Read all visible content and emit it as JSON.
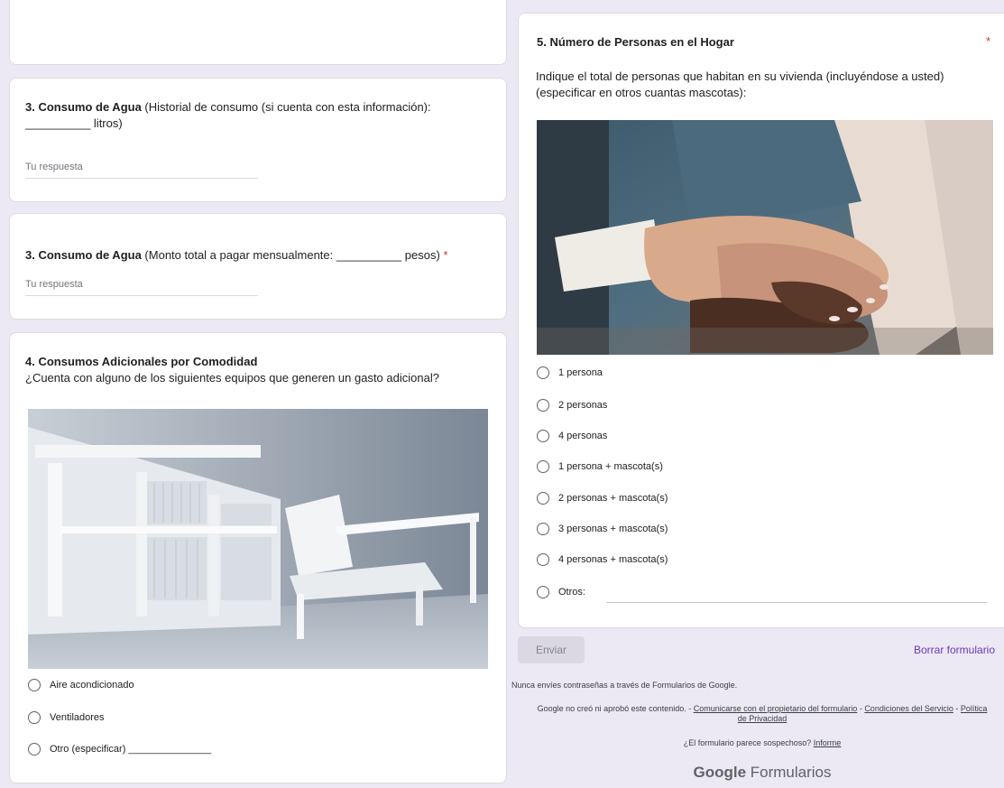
{
  "q3a": {
    "title_bold": "3. Consumo de Agua",
    "title_rest": " (Historial de consumo (si cuenta con esta información):",
    "title_line2": "__________ litros)",
    "placeholder": "Tu respuesta"
  },
  "q3b": {
    "title_bold": "3. Consumo de Agua",
    "title_rest": " (Monto total a pagar mensualmente: __________ pesos)",
    "required": "*",
    "placeholder": "Tu respuesta"
  },
  "q4": {
    "title_bold": "4. Consumos Adicionales por Comodidad",
    "description": "¿Cuenta con alguno de los siguientes equipos que generen un gasto adicional?",
    "options": [
      "Aire acondicionado",
      "Ventiladores",
      "Otro (especificar) _______________"
    ]
  },
  "q5": {
    "title_bold": "5. Número de Personas en el Hogar",
    "required": "*",
    "description_line1": "Indique el total de personas que habitan en su vivienda (incluyéndose a usted)",
    "description_line2": "(especificar en otros cuantas mascotas):",
    "options": [
      "1 persona",
      "2 personas",
      "4 personas",
      "1 persona + mascota(s)",
      "2 personas + mascota(s)",
      "3 personas + mascota(s)",
      "4 personas + mascota(s)",
      "Otros:"
    ]
  },
  "footer": {
    "submit_label": "Enviar",
    "clear_label": "Borrar formulario",
    "password_warning": "Nunca envíes contraseñas a través de Formularios de Google.",
    "disclaimer_prefix": "Google no creó ni aprobó este contenido. - ",
    "contact_owner_link": "Comunicarse con el propietario del formulario",
    "separator": " - ",
    "terms_link": "Condiciones del Servicio",
    "privacy_link": "Política de Privacidad",
    "suspicious_text": "¿El formulario parece sospechoso? ",
    "report_link": "Informe",
    "logo_google": "Google",
    "logo_product": " Formularios"
  },
  "colors": {
    "accent": "#673ab7",
    "required": "#d93025",
    "background": "#ece8f4"
  }
}
